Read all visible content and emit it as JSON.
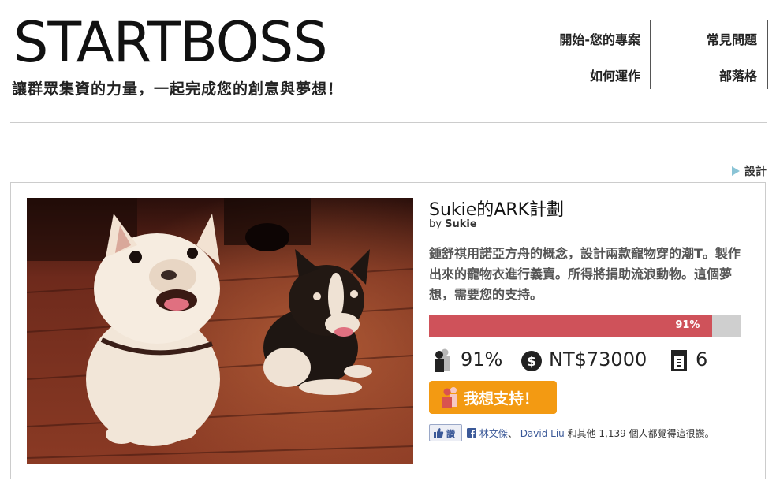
{
  "header": {
    "logo": "STARTBOSS",
    "tagline": "讓群眾集資的力量，一起完成您的創意與夢想！"
  },
  "nav": {
    "start_project": "開始-您的專案",
    "how_it_works": "如何運作",
    "faq": "常見問題",
    "blog": "部落格"
  },
  "category": "設計",
  "project": {
    "title": "Sukie的ARK計劃",
    "by_prefix": "by",
    "author": "Sukie",
    "description": "鍾舒祺用諾亞方舟的概念，設計兩款寵物穿的潮T。製作出來的寵物衣進行義賣。所得將捐助流浪動物。這個夢想，需要您的支持。",
    "progress_fraction": 0.91,
    "progress_label": "91%",
    "stats": {
      "funded": "91%",
      "amount": "NT$73000",
      "days": "6"
    },
    "support_button": "我想支持！"
  },
  "facebook": {
    "like_label": "讚",
    "friend1": "林文傑",
    "separator": "、",
    "friend2": "David Liu",
    "rest": "和其他 1,139 個人都覺得這很讚。"
  },
  "colors": {
    "progress_fill": "#cf525a",
    "progress_bg": "#cfcfcf",
    "support_button": "#f39a12",
    "category_arrow": "#8ac4d6",
    "facebook_blue": "#3b5998"
  },
  "icons": [
    "people-icon",
    "dollar-icon",
    "calendar-icon",
    "supporter-icon",
    "thumbs-up-icon",
    "facebook-icon"
  ]
}
